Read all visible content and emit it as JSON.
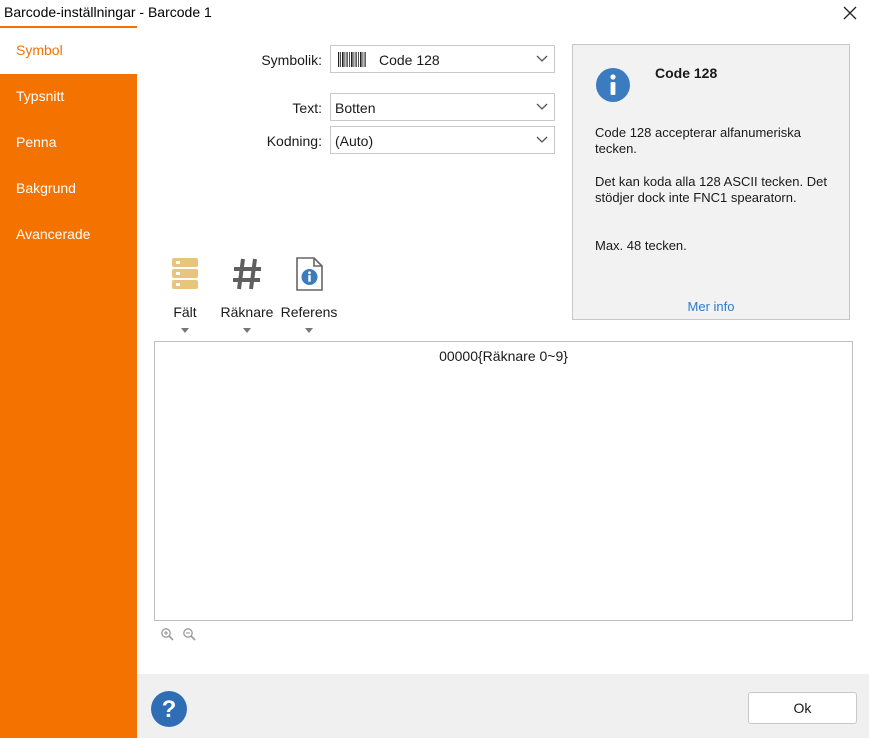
{
  "window": {
    "title": "Barcode-inställningar - Barcode 1",
    "close_icon": "close-icon"
  },
  "sidebar": {
    "accent": "#f47200",
    "items": [
      {
        "label": "Symbol",
        "active": true
      },
      {
        "label": "Typsnitt"
      },
      {
        "label": "Penna"
      },
      {
        "label": "Bakgrund"
      },
      {
        "label": "Avancerade"
      }
    ]
  },
  "form": {
    "symbology": {
      "label": "Symbolik:",
      "value": "Code 128",
      "icon": "barcode-icon"
    },
    "text": {
      "label": "Text:",
      "value": "Botten"
    },
    "encoding": {
      "label": "Kodning:",
      "value": "(Auto)"
    }
  },
  "info": {
    "icon": "info-icon",
    "title": "Code 128",
    "p1": "Code 128 accepterar alfanumeriska tecken.",
    "p2": "Det kan koda alla 128 ASCII tecken. Det stödjer dock inte FNC1 spearatorn.",
    "p3": "Max. 48 tecken.",
    "more": "Mer info"
  },
  "toolbar": {
    "items": [
      {
        "label": "Fält",
        "icon": "fields-icon"
      },
      {
        "label": "Räknare",
        "icon": "hash-icon"
      },
      {
        "label": "Referens",
        "icon": "document-info-icon"
      }
    ]
  },
  "editor": {
    "content": "00000{Räknare 0~9}"
  },
  "footer": {
    "ok_label": "Ok",
    "help_icon": "help-icon"
  }
}
